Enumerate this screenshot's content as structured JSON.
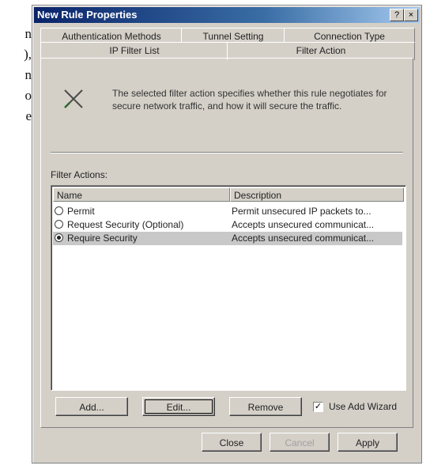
{
  "fragment_lines": [
    "n",
    "),",
    "n",
    "o",
    "e"
  ],
  "window": {
    "title": "New Rule Properties",
    "help_label": "?",
    "close_label": "×"
  },
  "tabs_row1": [
    "Authentication Methods",
    "Tunnel Setting",
    "Connection Type"
  ],
  "tabs_row2": [
    "IP Filter List",
    "Filter Action"
  ],
  "description": "The selected filter action specifies whether this rule negotiates for secure network traffic, and how it will secure the traffic.",
  "filter_actions_label": "Filter Actions:",
  "list": {
    "columns": [
      "Name",
      "Description"
    ],
    "rows": [
      {
        "name": "Permit",
        "description": "Permit unsecured IP packets to...",
        "selected": false
      },
      {
        "name": "Request Security (Optional)",
        "description": "Accepts unsecured communicat...",
        "selected": false
      },
      {
        "name": "Require Security",
        "description": "Accepts unsecured communicat...",
        "selected": true
      }
    ]
  },
  "buttons": {
    "add": "Add...",
    "edit": "Edit...",
    "remove": "Remove",
    "use_wizard_label": "Use Add Wizard",
    "use_wizard_checked": true,
    "close": "Close",
    "cancel": "Cancel",
    "apply": "Apply"
  },
  "icon_names": {
    "filter_action": "filter-action-icon"
  }
}
